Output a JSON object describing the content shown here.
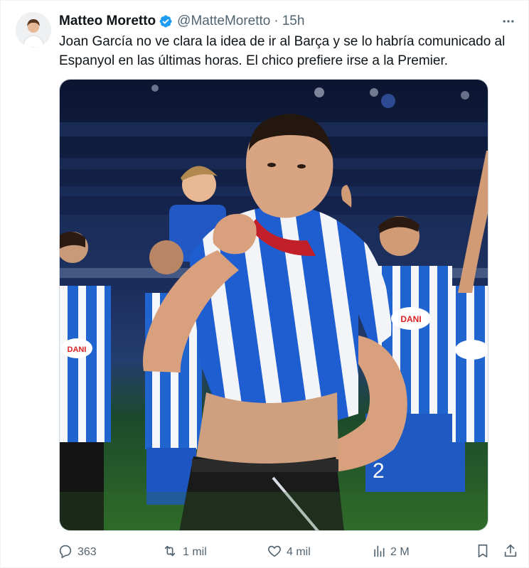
{
  "author": {
    "name": "Matteo Moretto",
    "handle": "@MatteMoretto",
    "separator": "·",
    "time": "15h",
    "verified": true
  },
  "tweet": {
    "text": "Joan García no ve clara la idea de ir al Barça y se lo habría comunicado al Espanyol en las últimas horas. El chico prefiere irse a la Premier."
  },
  "media": {
    "shirt_sponsor": "DANI"
  },
  "actions": {
    "replies": "363",
    "retweets": "1 mil",
    "likes": "4 mil",
    "views": "2 M"
  },
  "icons": {
    "verified": "verified-badge-icon",
    "more": "more-options-icon",
    "reply": "reply-icon",
    "retweet": "retweet-icon",
    "like": "heart-icon",
    "views": "views-icon",
    "bookmark": "bookmark-icon",
    "share": "share-icon"
  },
  "colors": {
    "verified_blue": "#1d9bf0",
    "text_primary": "#0f1419",
    "text_secondary": "#536471",
    "espanyol_blue": "#1e5fc4"
  }
}
